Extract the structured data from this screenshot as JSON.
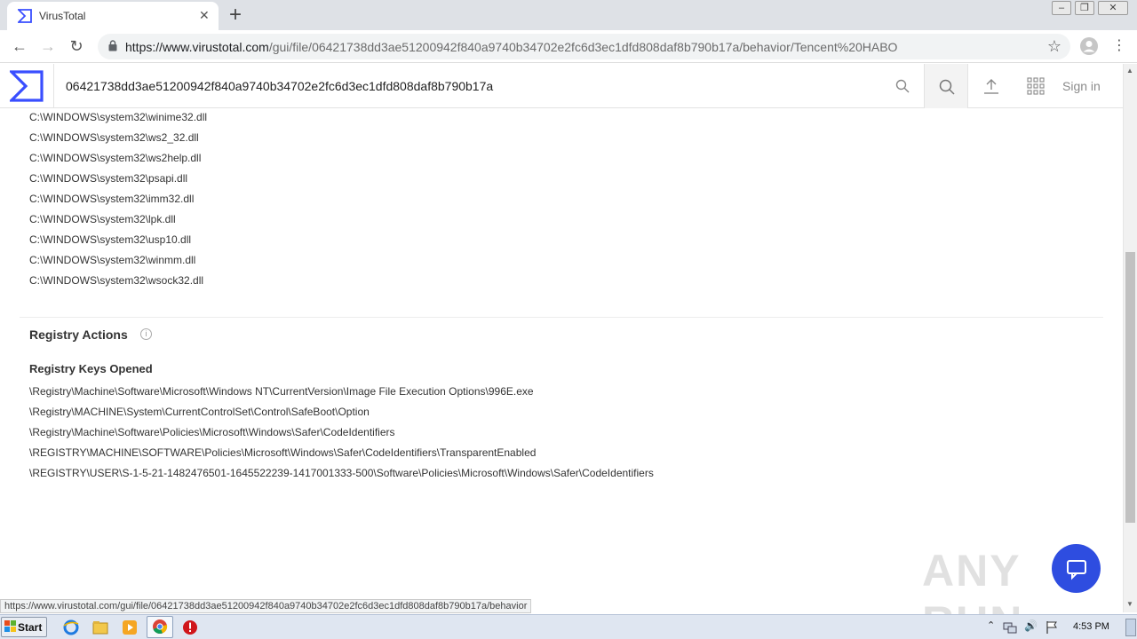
{
  "browser": {
    "tab_title": "VirusTotal",
    "url_host": "https://www.virustotal.com",
    "url_path": "/gui/file/06421738dd3ae51200942f840a9740b34702e2fc6d3ec1dfd808daf8b790b17a/behavior/Tencent%20HABO",
    "status_url": "https://www.virustotal.com/gui/file/06421738dd3ae51200942f840a9740b34702e2fc6d3ec1dfd808daf8b790b17a/behavior"
  },
  "vt_header": {
    "search_value": "06421738dd3ae51200942f840a9740b34702e2fc6d3ec1dfd808daf8b790b17a",
    "signin_label": "Sign in",
    "brand_color": "#394EFF"
  },
  "dll_paths": [
    "C:\\WINDOWS\\system32\\winime32.dll",
    "C:\\WINDOWS\\system32\\ws2_32.dll",
    "C:\\WINDOWS\\system32\\ws2help.dll",
    "C:\\WINDOWS\\system32\\psapi.dll",
    "C:\\WINDOWS\\system32\\imm32.dll",
    "C:\\WINDOWS\\system32\\lpk.dll",
    "C:\\WINDOWS\\system32\\usp10.dll",
    "C:\\WINDOWS\\system32\\winmm.dll",
    "C:\\WINDOWS\\system32\\wsock32.dll"
  ],
  "registry": {
    "section_title": "Registry Actions",
    "keys_opened_title": "Registry Keys Opened",
    "keys_opened": [
      "\\Registry\\Machine\\Software\\Microsoft\\Windows NT\\CurrentVersion\\Image File Execution Options\\996E.exe",
      "\\Registry\\MACHINE\\System\\CurrentControlSet\\Control\\SafeBoot\\Option",
      "\\Registry\\Machine\\Software\\Policies\\Microsoft\\Windows\\Safer\\CodeIdentifiers",
      "\\REGISTRY\\MACHINE\\SOFTWARE\\Policies\\Microsoft\\Windows\\Safer\\CodeIdentifiers\\TransparentEnabled",
      "\\REGISTRY\\USER\\S-1-5-21-1482476501-1645522239-1417001333-500\\Software\\Policies\\Microsoft\\Windows\\Safer\\CodeIdentifiers"
    ]
  },
  "watermark": {
    "text": "ANY RUN"
  },
  "taskbar": {
    "start_label": "Start",
    "clock": "4:53 PM"
  }
}
